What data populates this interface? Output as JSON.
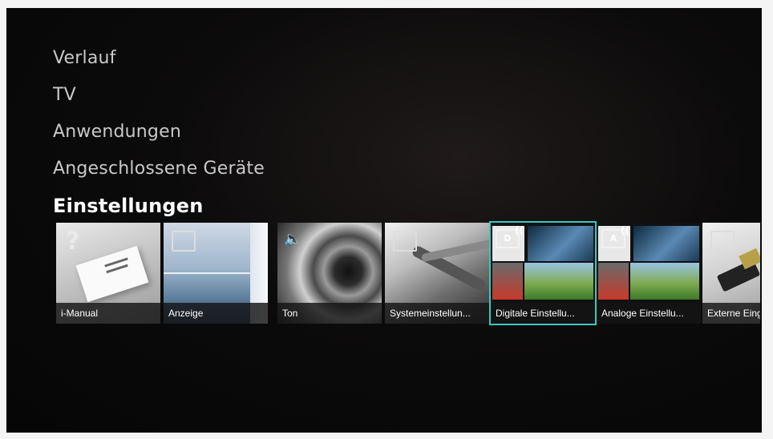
{
  "menu": {
    "items": [
      {
        "label": "Verlauf"
      },
      {
        "label": "TV"
      },
      {
        "label": "Anwendungen"
      },
      {
        "label": "Angeschlossene Geräte"
      },
      {
        "label": "Einstellungen"
      }
    ],
    "active_index": 4
  },
  "settings_tiles": [
    {
      "label": "i-Manual",
      "icon": "question-icon"
    },
    {
      "label": "Anzeige",
      "icon": "picture-icon"
    },
    {
      "label": "Ton",
      "icon": "speaker-icon"
    },
    {
      "label": "Systemeinstellun...",
      "icon": "list-icon"
    },
    {
      "label": "Digitale Einstellu...",
      "icon": "d-broadcast-icon",
      "badge": "D",
      "selected": true
    },
    {
      "label": "Analoge Einstellu...",
      "icon": "a-broadcast-icon",
      "badge": "A"
    },
    {
      "label": "Externe Eing",
      "icon": "input-icon"
    }
  ],
  "colors": {
    "selection_outline": "#37c9c1",
    "menu_text": "#c9c9c9",
    "active_text": "#ffffff"
  }
}
